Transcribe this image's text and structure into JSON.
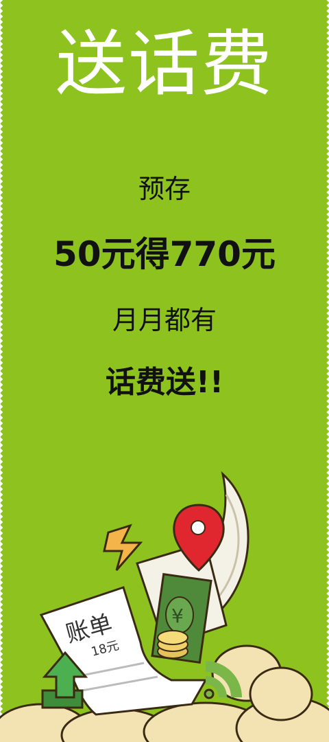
{
  "title": "送话费",
  "lines": {
    "l1": "预存",
    "l2": "50元得770元",
    "l3": "月月都有",
    "l4": "话费送!!"
  },
  "illustration": {
    "bill_text": "账单",
    "bill_amount": "18元",
    "money_symbol": "¥",
    "icons": [
      "location-pin-icon",
      "lightning-icon",
      "upload-arrow-icon",
      "wifi-signal-icon"
    ]
  },
  "colors": {
    "background": "#8dc21f",
    "title": "#ffffff",
    "text": "#111111"
  }
}
